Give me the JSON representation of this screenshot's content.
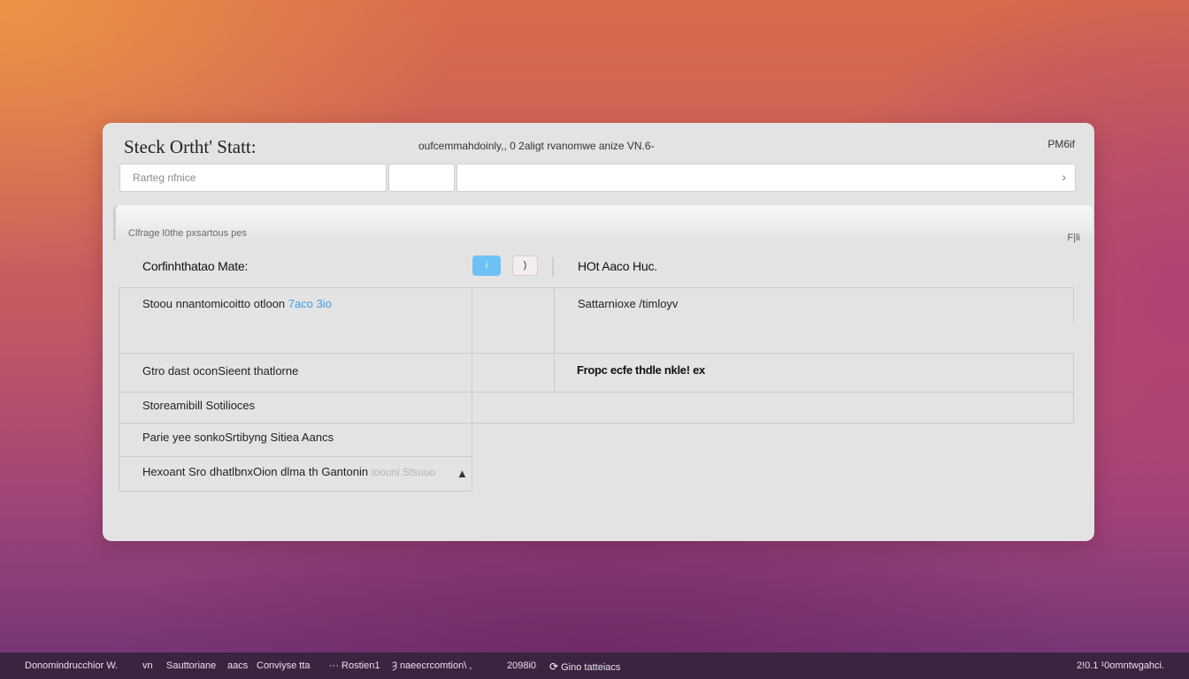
{
  "window": {
    "title": "Steck Ortht' Statt:",
    "subtitle": "oufcemmahdoinly,, 0 2aligt rvanomwe anize VN.6-",
    "corner_label": "PM6if"
  },
  "toolbar": {
    "search_placeholder": "Rarteg nfnice",
    "path_chevron": "›"
  },
  "band": {
    "caption": "Clfrage l0the pxsartous pes",
    "icon_label": "F|li"
  },
  "left_panel": {
    "title": "Corfinhthatao Mate:",
    "toggle_on_label": "i",
    "toggle_off_label": ")",
    "rows": [
      {
        "text": "Stoou nnantomicoitto otloon",
        "link": "7aco 3io"
      },
      {
        "text": ""
      },
      {
        "text": "Gtro dast oconSieent thatlorne"
      },
      {
        "text": "Storeamibill Sotilioces"
      },
      {
        "text": "Parie yee sonkoSrtibyng Sitiea Aancs"
      },
      {
        "text": "Hexoant Sro dhatlbnxOion dlma th Gantonin",
        "ghost": "ioouni  Stsuuo"
      }
    ]
  },
  "right_panel": {
    "title": "HOt Aaco Huc.",
    "rows": [
      {
        "text": "Sattarnioxe /timloyv"
      },
      {
        "text": ""
      },
      {
        "text": "Fropc ecfe thdle nkle! ex"
      }
    ]
  },
  "taskbar": {
    "items": [
      {
        "label": "Donomindrucchior W."
      },
      {
        "label": "vn"
      },
      {
        "label": "Sauttoriane"
      },
      {
        "label": "aacs"
      },
      {
        "label": "Conviyse tta"
      },
      {
        "label": "··· Rostien1"
      },
      {
        "label": "Ȝ  naeecrcomtion\\ ,"
      },
      {
        "label": "2098i0"
      },
      {
        "label": "Gino tatteiacs",
        "icon": "refresh-icon"
      },
      {
        "label": "2!0.1 ¹0omntwgahci."
      }
    ]
  }
}
